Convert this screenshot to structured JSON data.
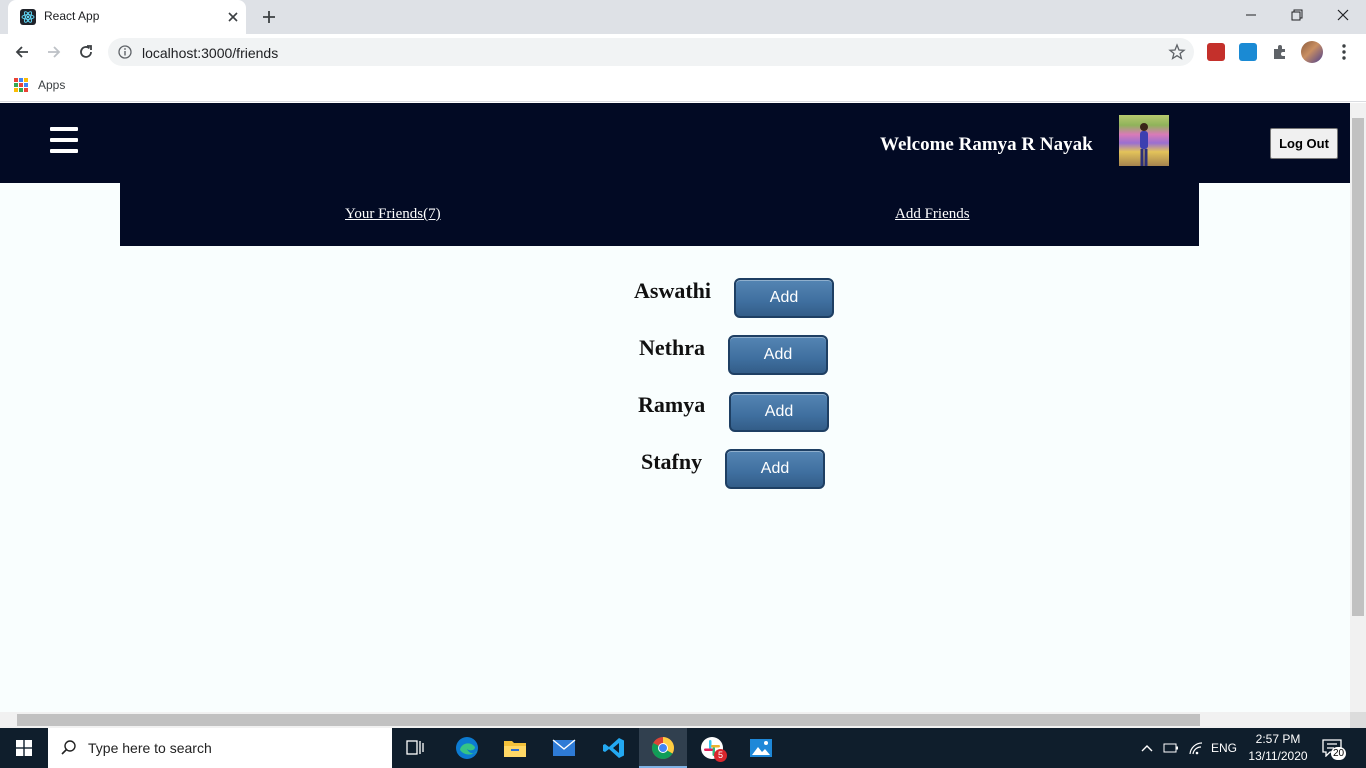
{
  "browser": {
    "tab_title": "React App",
    "url": "localhost:3000/friends",
    "bookmarks": {
      "apps_label": "Apps"
    }
  },
  "header": {
    "welcome_text": "Welcome Ramya R Nayak",
    "logout_label": "Log Out"
  },
  "subnav": {
    "your_friends_label": "Your Friends(7)",
    "add_friends_label": "Add Friends"
  },
  "friends": [
    {
      "name": "Aswathi",
      "button": "Add"
    },
    {
      "name": "Nethra",
      "button": "Add"
    },
    {
      "name": "Ramya",
      "button": "Add"
    },
    {
      "name": "Stafny",
      "button": "Add"
    }
  ],
  "taskbar": {
    "search_placeholder": "Type here to search",
    "language": "ENG",
    "time": "2:57 PM",
    "date": "13/11/2020",
    "notification_count": "20",
    "slack_badge": "5"
  },
  "colors": {
    "header_bg": "#020a24",
    "page_bg": "#f9fefe",
    "add_button": "#3f6f9f"
  }
}
